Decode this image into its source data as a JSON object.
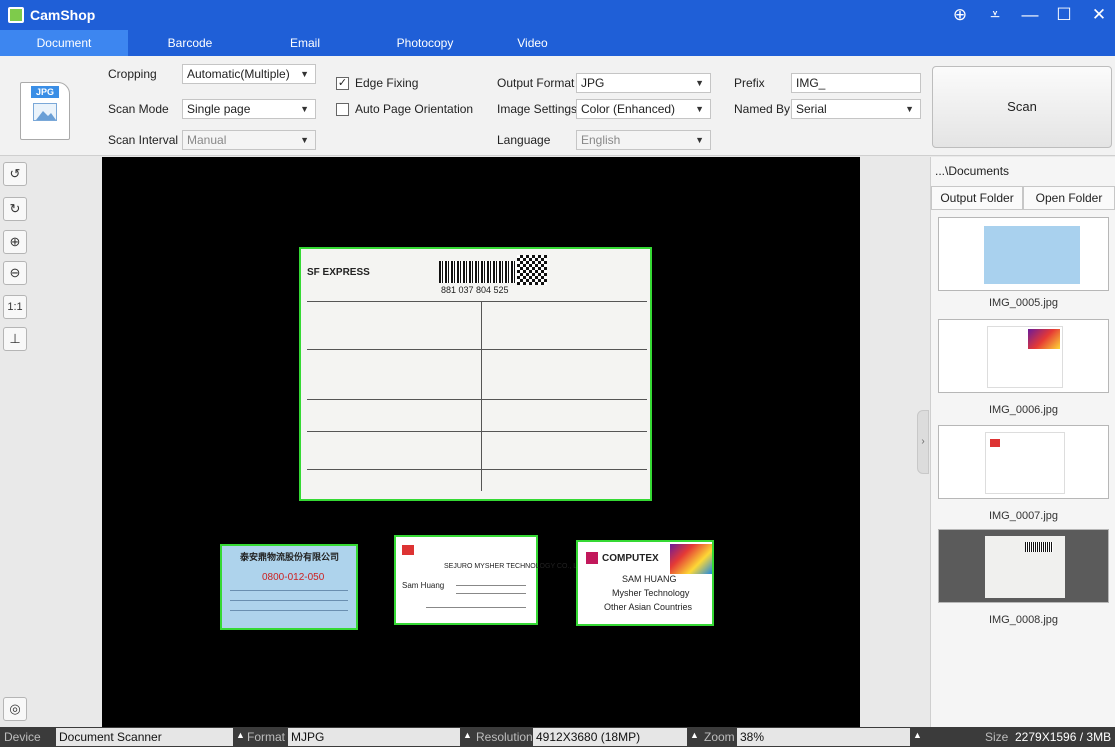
{
  "app": {
    "title": "CamShop"
  },
  "tabs": [
    {
      "label": "Document",
      "active": true
    },
    {
      "label": "Barcode"
    },
    {
      "label": "Email"
    },
    {
      "label": "Photocopy"
    },
    {
      "label": "Video"
    }
  ],
  "toolbar": {
    "doc_icon_tag": "JPG",
    "cropping": {
      "label": "Cropping",
      "value": "Automatic(Multiple)"
    },
    "scan_mode": {
      "label": "Scan Mode",
      "value": "Single page"
    },
    "scan_interval": {
      "label": "Scan Interval",
      "value": "Manual"
    },
    "edge_fixing": {
      "label": "Edge Fixing",
      "checked": true
    },
    "auto_page_orientation": {
      "label": "Auto Page Orientation",
      "checked": false
    },
    "output_format": {
      "label": "Output Format",
      "value": "JPG"
    },
    "image_settings": {
      "label": "Image Settings",
      "value": "Color (Enhanced)"
    },
    "language": {
      "label": "Language",
      "value": "English"
    },
    "prefix": {
      "label": "Prefix",
      "value": "IMG_"
    },
    "named_by": {
      "label": "Named By",
      "value": "Serial"
    },
    "scan_label": "Scan"
  },
  "viewer": {
    "waybill": {
      "logo": "SF EXPRESS",
      "tracking": "881  037  804  525"
    },
    "card1": {
      "company": "泰安鼎物流股份有限公司",
      "phone": "0800-012-050"
    },
    "card2": {
      "name": "Sam Huang",
      "company": "SEJURO MYSHER TECHNOLOGY CO., LTD."
    },
    "card3": {
      "brand": "COMPUTEX",
      "name": "SAM HUANG",
      "company": "Mysher Technology",
      "country": "Other Asian Countries"
    }
  },
  "right_panel": {
    "path": "...\\Documents",
    "output_folder_label": "Output Folder",
    "open_folder_label": "Open Folder",
    "thumbnails": [
      {
        "name": "IMG_0005.jpg"
      },
      {
        "name": "IMG_0006.jpg"
      },
      {
        "name": "IMG_0007.jpg"
      },
      {
        "name": "IMG_0008.jpg",
        "selected": true
      }
    ]
  },
  "status": {
    "device_label": "Device",
    "device_value": "Document Scanner",
    "format_label": "Format",
    "format_value": "MJPG",
    "resolution_label": "Resolution",
    "resolution_value": "4912X3680 (18MP)",
    "zoom_label": "Zoom",
    "zoom_value": "38%",
    "size_label": "Size",
    "size_value": "2279X1596 / 3MB"
  },
  "colors": {
    "titlebar": "#1f5fd7",
    "active_tab": "#3d86f0",
    "crop_border": "#35d934",
    "status_bar": "#3b3b3b"
  }
}
